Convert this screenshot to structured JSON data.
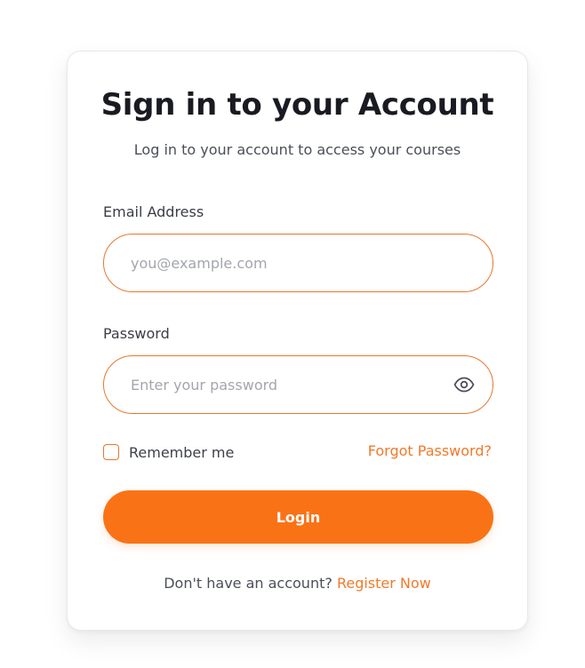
{
  "form": {
    "title": "Sign in to your Account",
    "subtitle": "Log in to your account to access your courses",
    "email": {
      "label": "Email Address",
      "value": "",
      "placeholder": "you@example.com"
    },
    "password": {
      "label": "Password",
      "value": "",
      "placeholder": "Enter your password",
      "toggle_icon": "eye-icon"
    },
    "remember_me": {
      "label": "Remember me",
      "checked": false
    },
    "forgot_password": "Forgot Password?",
    "login_button": "Login",
    "register_prompt": "Don't have an account?",
    "register_link": "Register Now"
  },
  "colors": {
    "accent": "#f97316",
    "link": "#f07a2a",
    "title": "#1a1a22",
    "text": "#4b4f58"
  }
}
